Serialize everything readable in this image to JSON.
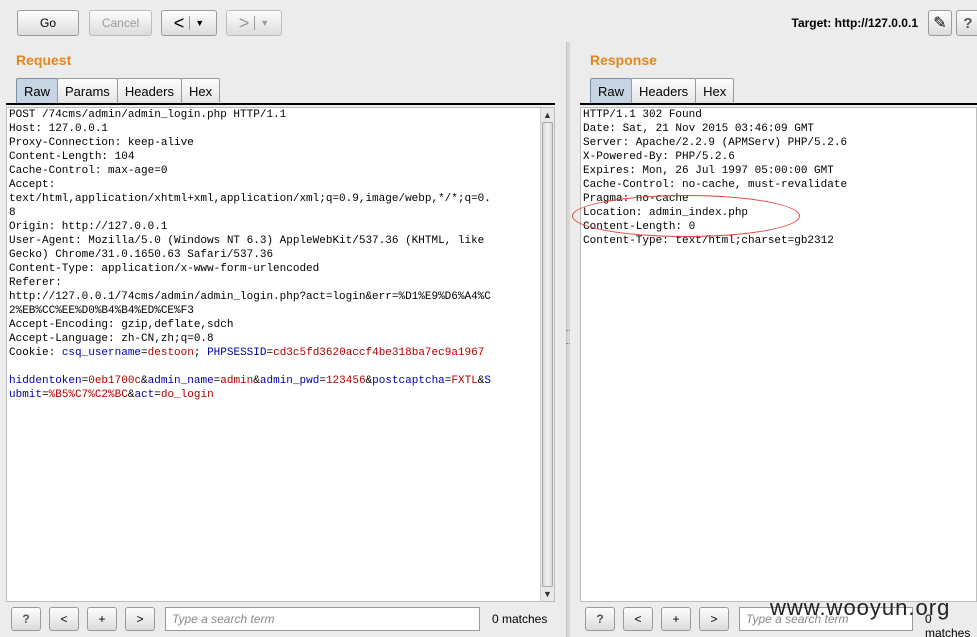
{
  "toolbar": {
    "go_label": "Go",
    "cancel_label": "Cancel",
    "back_arrow": "<",
    "forward_arrow": ">",
    "dropdown_caret": "▼",
    "target_label": "Target: http://127.0.0.1",
    "edit_icon": "✎",
    "help_icon": "?"
  },
  "request": {
    "title": "Request",
    "tabs": [
      "Raw",
      "Params",
      "Headers",
      "Hex"
    ],
    "active_tab": "Raw",
    "lines": [
      "POST /74cms/admin/admin_login.php HTTP/1.1",
      "Host: 127.0.0.1",
      "Proxy-Connection: keep-alive",
      "Content-Length: 104",
      "Cache-Control: max-age=0",
      "Accept:",
      "text/html,application/xhtml+xml,application/xml;q=0.9,image/webp,*/*;q=0.",
      "8",
      "Origin: http://127.0.0.1",
      "User-Agent: Mozilla/5.0 (Windows NT 6.3) AppleWebKit/537.36 (KHTML, like",
      "Gecko) Chrome/31.0.1650.63 Safari/537.36",
      "Content-Type: application/x-www-form-urlencoded",
      "Referer:",
      "http://127.0.0.1/74cms/admin/admin_login.php?act=login&err=%D1%E9%D6%A4%C",
      "2%EB%CC%EE%D0%B4%B4%ED%CE%F3",
      "Accept-Encoding: gzip,deflate,sdch",
      "Accept-Language: zh-CN,zh;q=0.8"
    ],
    "cookie_prefix": "Cookie: ",
    "cookie": [
      {
        "k": "csq_username",
        "v": "destoon"
      },
      {
        "k": "PHPSESSID",
        "v": "cd3c5fd3620accf4be318ba7ec9a1967"
      }
    ],
    "body_line1": [
      {
        "k": "hiddentoken",
        "v": "0eb1700c"
      },
      {
        "k": "admin_name",
        "v": "admin"
      },
      {
        "k": "admin_pwd",
        "v": "123456"
      },
      {
        "k": "postcaptcha",
        "v": "FXTL"
      }
    ],
    "body_line1_tail": "S",
    "body_line2_key": "ubmit",
    "body_line2_val": "%B5%C7%C2%BC",
    "body_line2_k2": "act",
    "body_line2_v2": "do_login"
  },
  "response": {
    "title": "Response",
    "tabs": [
      "Raw",
      "Headers",
      "Hex"
    ],
    "active_tab": "Raw",
    "lines": [
      "HTTP/1.1 302 Found",
      "Date: Sat, 21 Nov 2015 03:46:09 GMT",
      "Server: Apache/2.2.9 (APMServ) PHP/5.2.6",
      "X-Powered-By: PHP/5.2.6",
      "Expires: Mon, 26 Jul 1997 05:00:00 GMT",
      "Cache-Control: no-cache, must-revalidate",
      "Pragma: no-cache",
      "Location: admin_index.php",
      "Content-Length: 0",
      "Content-Type: text/html;charset=gb2312"
    ]
  },
  "search_bar": {
    "help": "?",
    "prev": "<",
    "add": "+",
    "next": ">",
    "placeholder": "Type a search term",
    "matches": "0 matches"
  },
  "watermark": "www.wooyun.org"
}
